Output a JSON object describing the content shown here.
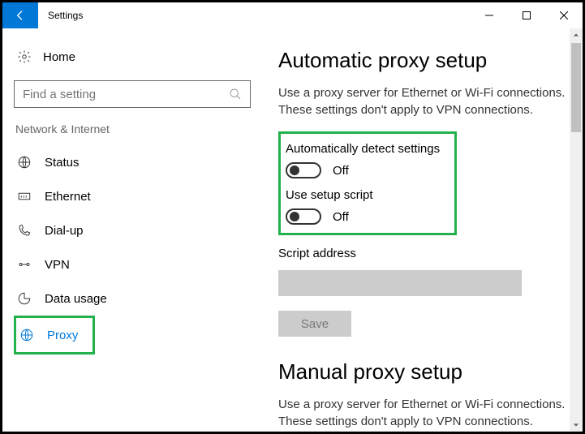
{
  "titlebar": {
    "title": "Settings"
  },
  "sidebar": {
    "home_label": "Home",
    "search_placeholder": "Find a setting",
    "section_header": "Network & Internet",
    "items": [
      {
        "label": "Status"
      },
      {
        "label": "Ethernet"
      },
      {
        "label": "Dial-up"
      },
      {
        "label": "VPN"
      },
      {
        "label": "Data usage"
      },
      {
        "label": "Proxy"
      }
    ]
  },
  "main": {
    "auto_heading": "Automatic proxy setup",
    "auto_desc": "Use a proxy server for Ethernet or Wi-Fi connections. These settings don't apply to VPN connections.",
    "auto_detect_label": "Automatically detect settings",
    "auto_detect_state": "Off",
    "use_script_label": "Use setup script",
    "use_script_state": "Off",
    "script_address_label": "Script address",
    "script_address_value": "",
    "save_label": "Save",
    "manual_heading": "Manual proxy setup",
    "manual_desc": "Use a proxy server for Ethernet or Wi-Fi connections. These settings don't apply to VPN connections."
  }
}
